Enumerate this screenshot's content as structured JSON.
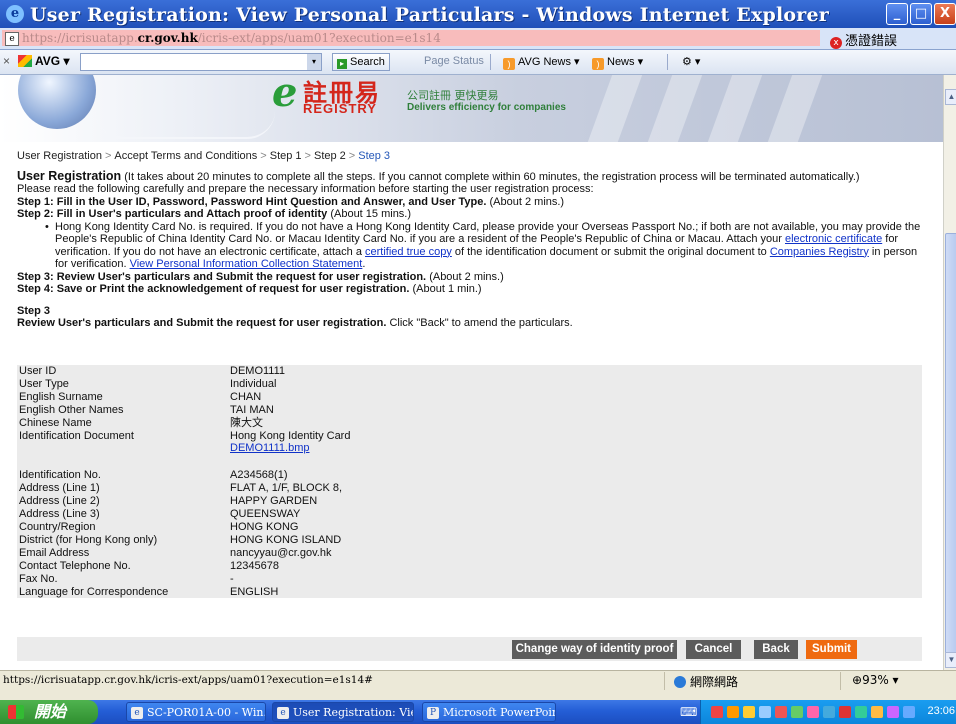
{
  "window": {
    "title": "User Registration: View Personal Particulars - Windows Internet Explorer",
    "min_label": "_",
    "max_label": "□",
    "close_label": "X"
  },
  "address": {
    "prefix": "https://icrisuatapp.",
    "host": "cr.gov.hk",
    "path": "/icris-ext/apps/uam01?execution=e1s14",
    "cert_error": "憑證錯誤"
  },
  "toolbar": {
    "avg_label": "AVG",
    "search_label": "Search",
    "page_status": "Page Status",
    "avg_news": "AVG News",
    "news": "News"
  },
  "banner": {
    "logo_zh": "註冊易",
    "logo_en": "REGISTRY",
    "tagline_zh": "公司註冊 更快更易",
    "tagline_en": "Delivers efficiency for companies"
  },
  "breadcrumb": [
    "User Registration",
    "Accept Terms and Conditions",
    "Step 1",
    "Step 2",
    "Step 3"
  ],
  "intro": {
    "heading": "User Registration",
    "heading_note": "(It takes about 20 minutes to complete all the steps. If you cannot complete within 60 minutes, the registration process will be terminated automatically.)",
    "prepare": "Please read the following carefully and prepare the necessary information before starting the user registration process:",
    "step1_bold": "Step 1: Fill in the User ID, Password, Password Hint Question and Answer, and User Type.",
    "step1_time": "(About 2 mins.)",
    "step2_bold": "Step 2: Fill in User's particulars and Attach proof of identity",
    "step2_time": "(About 15 mins.)",
    "bullet_a": "Hong Kong Identity Card No. is required. If you do not have a Hong Kong Identity Card, please provide your Overseas Passport No.; if both are not available, you may provide the People's Republic of China Identity Card No. or Macau Identity Card No. if you are a resident of the People's Republic of China or Macau. Attach your ",
    "link_cert": "electronic certificate",
    "bullet_b": " for verification. If you do not have an electronic certificate, attach a ",
    "link_copy": "certified true copy",
    "bullet_c": " of the identification document or submit the original document to ",
    "link_cr": "Companies Registry",
    "bullet_d": " in person for verification. ",
    "link_pics": "View Personal Information Collection Statement",
    "bullet_e": ".",
    "step3_bold": "Step 3: Review User's particulars and Submit the request for user registration.",
    "step3_time": "(About 2 mins.)",
    "step4_bold": "Step 4: Save or Print the acknowledgement of request for user registration.",
    "step4_time": "(About 1 min.)",
    "section_title": "Step 3",
    "review_bold": "Review User's particulars and Submit the request for user registration.",
    "review_note": " Click \"Back\" to amend the particulars."
  },
  "details": [
    {
      "label": "User ID",
      "value": "DEMO1111"
    },
    {
      "label": "User Type",
      "value": "Individual"
    },
    {
      "label": "English Surname",
      "value": "CHAN"
    },
    {
      "label": "English Other Names",
      "value": "TAI MAN"
    },
    {
      "label": "Chinese Name",
      "value": "陳大文"
    },
    {
      "label": "Identification Document",
      "value": "Hong Kong Identity Card"
    },
    {
      "label": "",
      "value": "DEMO1111.bmp"
    },
    {
      "label": "",
      "value": ""
    },
    {
      "label": "Identification No.",
      "value": "A234568(1)"
    },
    {
      "label": "Address (Line 1)",
      "value": "FLAT A, 1/F, BLOCK 8,"
    },
    {
      "label": "Address (Line 2)",
      "value": "HAPPY GARDEN"
    },
    {
      "label": "Address (Line 3)",
      "value": "QUEENSWAY"
    },
    {
      "label": "Country/Region",
      "value": "HONG KONG"
    },
    {
      "label": "District (for Hong Kong only)",
      "value": "HONG KONG ISLAND"
    },
    {
      "label": "Email Address",
      "value": "nancyyau@cr.gov.hk"
    },
    {
      "label": "Contact Telephone No.",
      "value": "12345678"
    },
    {
      "label": "Fax No.",
      "value": "-"
    },
    {
      "label": "Language for Correspondence",
      "value": "ENGLISH"
    }
  ],
  "buttons": {
    "change": "Change way of identity proof",
    "cancel": "Cancel",
    "back": "Back",
    "submit": "Submit"
  },
  "status": {
    "url": "https://icrisuatapp.cr.gov.hk/icris-ext/apps/uam01?execution=e1s14#",
    "zone": "網際網路",
    "zoom": "93%"
  },
  "taskbar": {
    "start": "開始",
    "tasks": [
      "SC-POR01A-00 - Win...",
      "User Registration: Vie...",
      "Microsoft PowerPoint ..."
    ],
    "clock": "23:06"
  },
  "colors": {
    "submit": "#ef6a10",
    "button": "#5c5c5c",
    "link": "#1032c8",
    "logo_red": "#d4261b",
    "logo_green": "#2a9d3a"
  }
}
